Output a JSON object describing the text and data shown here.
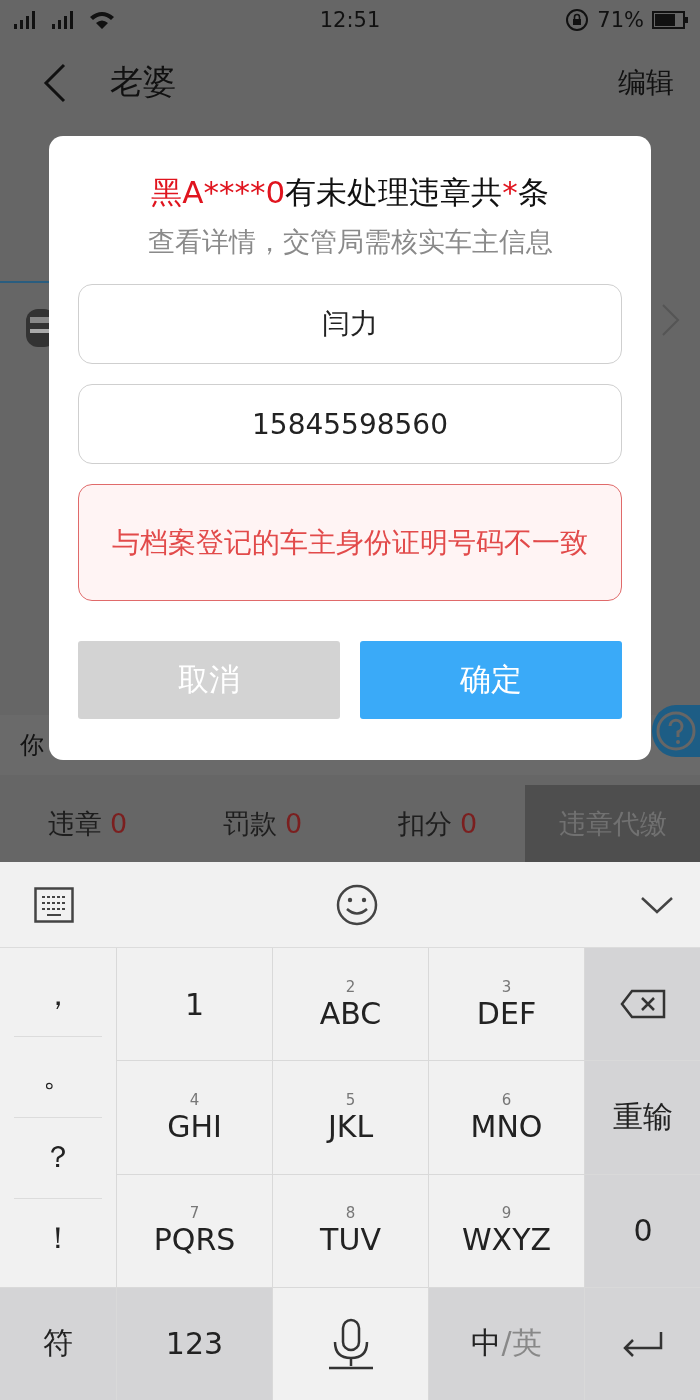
{
  "status_bar": {
    "time": "12:51",
    "battery": "71%"
  },
  "header": {
    "title": "老婆",
    "action": "编辑"
  },
  "background": {
    "row_text": "你"
  },
  "stats": [
    {
      "label": "违章",
      "value": "0"
    },
    {
      "label": "罚款",
      "value": "0"
    },
    {
      "label": "扣分",
      "value": "0"
    }
  ],
  "pay_button": "违章代缴",
  "dialog": {
    "title": [
      {
        "text": "黑A****0",
        "kind": "highlight"
      },
      {
        "text": "有未处理违章共",
        "kind": "plain"
      },
      {
        "text": "*",
        "kind": "highlight"
      },
      {
        "text": "条",
        "kind": "plain"
      }
    ],
    "subtitle": "查看详情，交管局需核实车主信息",
    "name_value": "闫力",
    "phone_value": "15845598560",
    "error": "与档案登记的车主身份证明号码不一致",
    "buttons": [
      {
        "label": "取消",
        "kind": "cancel"
      },
      {
        "label": "确定",
        "kind": "confirm"
      }
    ]
  },
  "keyboard": {
    "symbols": [
      "，",
      "。",
      "？",
      "！"
    ],
    "keys": [
      {
        "kind": "char",
        "label": "1"
      },
      {
        "kind": "letters",
        "number": "2",
        "letters": "ABC"
      },
      {
        "kind": "letters",
        "number": "3",
        "letters": "DEF"
      },
      {
        "kind": "backspace"
      },
      {
        "kind": "letters",
        "number": "4",
        "letters": "GHI"
      },
      {
        "kind": "letters",
        "number": "5",
        "letters": "JKL"
      },
      {
        "kind": "letters",
        "number": "6",
        "letters": "MNO"
      },
      {
        "kind": "function",
        "label": "重输"
      },
      {
        "kind": "letters",
        "number": "7",
        "letters": "PQRS"
      },
      {
        "kind": "letters",
        "number": "8",
        "letters": "TUV"
      },
      {
        "kind": "letters",
        "number": "9",
        "letters": "WXYZ"
      },
      {
        "kind": "function",
        "label": "0"
      },
      {
        "kind": "function",
        "label": "符"
      },
      {
        "kind": "function",
        "label": "123"
      },
      {
        "kind": "mic"
      },
      {
        "kind": "lang",
        "main": "中",
        "alt": "/英"
      },
      {
        "kind": "enter"
      }
    ]
  }
}
